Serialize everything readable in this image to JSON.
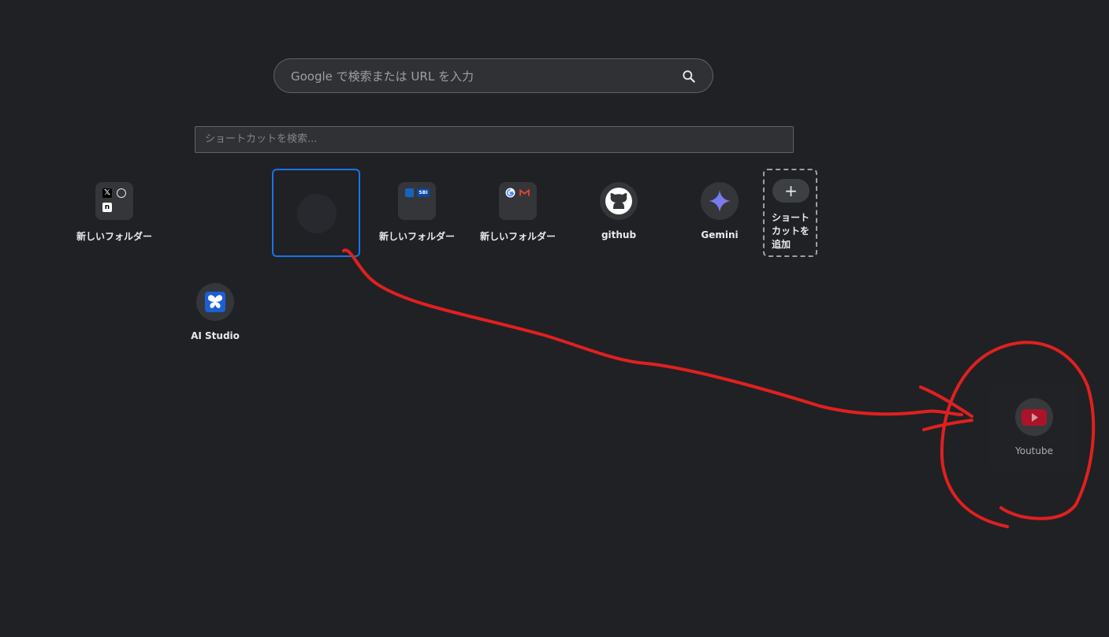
{
  "search": {
    "placeholder": "Google で検索または URL を入力",
    "icon": "search-icon"
  },
  "shortcut_search": {
    "placeholder": "ショートカットを検索..."
  },
  "shortcuts": [
    {
      "label": "新しいフォルダー",
      "icon": "folder-icon"
    },
    {
      "label": "新しいフォルダー",
      "icon": "folder-icon"
    },
    {
      "label": "新しいフォルダー",
      "icon": "folder-icon"
    },
    {
      "label": "github",
      "icon": "github-icon"
    },
    {
      "label": "Gemini",
      "icon": "gemini-icon"
    },
    {
      "label": "AI Studio",
      "icon": "ai-studio-icon"
    }
  ],
  "add_shortcut": {
    "label": "ショートカットを追加",
    "icon": "plus-icon",
    "glyph": "+"
  },
  "dragging_tile": {
    "label": "Youtube",
    "icon": "youtube-icon"
  },
  "folder1_minis": [
    "𝕏",
    "n"
  ],
  "folder2_minis": [
    "SBI"
  ],
  "colors": {
    "background": "#202124",
    "drop_target_border": "#1a73e8",
    "annotation": "#e02020",
    "youtube": "#c4122f"
  }
}
